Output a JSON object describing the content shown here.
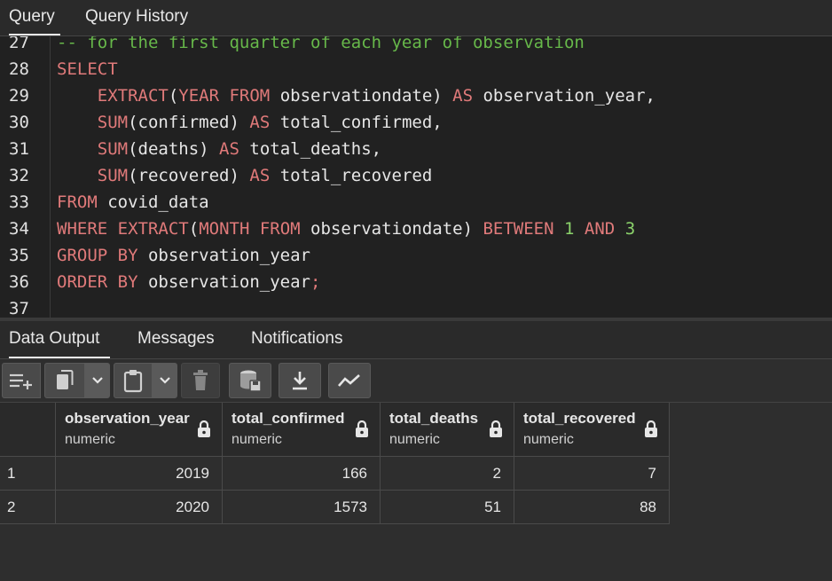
{
  "top_tabs": [
    {
      "label": "Query"
    },
    {
      "label": "Query History"
    }
  ],
  "editor": {
    "lines": [
      {
        "no": "27",
        "tokens": [
          {
            "t": "-- for the first quarter of each year of observation",
            "c": "cmt"
          }
        ]
      },
      {
        "no": "28",
        "tokens": [
          {
            "t": "SELECT",
            "c": "kw"
          }
        ]
      },
      {
        "no": "29",
        "tokens": [
          {
            "t": "    ",
            "c": "txt"
          },
          {
            "t": "EXTRACT",
            "c": "kw"
          },
          {
            "t": "(",
            "c": "txt"
          },
          {
            "t": "YEAR FROM",
            "c": "kw"
          },
          {
            "t": " observationdate) ",
            "c": "txt"
          },
          {
            "t": "AS",
            "c": "kw"
          },
          {
            "t": " observation_year,",
            "c": "txt"
          }
        ]
      },
      {
        "no": "30",
        "tokens": [
          {
            "t": "    ",
            "c": "txt"
          },
          {
            "t": "SUM",
            "c": "kw"
          },
          {
            "t": "(confirmed) ",
            "c": "txt"
          },
          {
            "t": "AS",
            "c": "kw"
          },
          {
            "t": " total_confirmed,",
            "c": "txt"
          }
        ]
      },
      {
        "no": "31",
        "tokens": [
          {
            "t": "    ",
            "c": "txt"
          },
          {
            "t": "SUM",
            "c": "kw"
          },
          {
            "t": "(deaths) ",
            "c": "txt"
          },
          {
            "t": "AS",
            "c": "kw"
          },
          {
            "t": " total_deaths,",
            "c": "txt"
          }
        ]
      },
      {
        "no": "32",
        "tokens": [
          {
            "t": "    ",
            "c": "txt"
          },
          {
            "t": "SUM",
            "c": "kw"
          },
          {
            "t": "(recovered) ",
            "c": "txt"
          },
          {
            "t": "AS",
            "c": "kw"
          },
          {
            "t": " total_recovered",
            "c": "txt"
          }
        ]
      },
      {
        "no": "33",
        "tokens": [
          {
            "t": "FROM",
            "c": "kw"
          },
          {
            "t": " covid_data",
            "c": "txt"
          }
        ]
      },
      {
        "no": "34",
        "tokens": [
          {
            "t": "WHERE",
            "c": "kw"
          },
          {
            "t": " ",
            "c": "txt"
          },
          {
            "t": "EXTRACT",
            "c": "kw"
          },
          {
            "t": "(",
            "c": "txt"
          },
          {
            "t": "MONTH FROM",
            "c": "kw"
          },
          {
            "t": " observationdate) ",
            "c": "txt"
          },
          {
            "t": "BETWEEN",
            "c": "kw"
          },
          {
            "t": " ",
            "c": "txt"
          },
          {
            "t": "1",
            "c": "num"
          },
          {
            "t": " ",
            "c": "txt"
          },
          {
            "t": "AND",
            "c": "kw"
          },
          {
            "t": " ",
            "c": "txt"
          },
          {
            "t": "3",
            "c": "num"
          }
        ]
      },
      {
        "no": "35",
        "tokens": [
          {
            "t": "GROUP BY",
            "c": "kw"
          },
          {
            "t": " observation_year",
            "c": "txt"
          }
        ]
      },
      {
        "no": "36",
        "tokens": [
          {
            "t": "ORDER BY",
            "c": "kw"
          },
          {
            "t": " observation_year",
            "c": "txt"
          },
          {
            "t": ";",
            "c": "kw"
          }
        ]
      },
      {
        "no": "37",
        "tokens": []
      }
    ]
  },
  "bottom_tabs": [
    {
      "label": "Data Output"
    },
    {
      "label": "Messages"
    },
    {
      "label": "Notifications"
    }
  ],
  "toolbar": {
    "icons": [
      "add-row-icon",
      "copy-icon",
      "chevron-down-icon",
      "paste-icon",
      "chevron-down-icon",
      "delete-icon",
      "save-data-icon",
      "download-icon",
      "graph-icon"
    ]
  },
  "grid": {
    "columns": [
      {
        "name": "observation_year",
        "type": "numeric"
      },
      {
        "name": "total_confirmed",
        "type": "numeric"
      },
      {
        "name": "total_deaths",
        "type": "numeric"
      },
      {
        "name": "total_recovered",
        "type": "numeric"
      }
    ],
    "rows": [
      {
        "n": "1",
        "cells": [
          "2019",
          "166",
          "2",
          "7"
        ]
      },
      {
        "n": "2",
        "cells": [
          "2020",
          "1573",
          "51",
          "88"
        ]
      }
    ]
  },
  "colors": {
    "keyword": "#e07a7a",
    "number": "#8bd36b",
    "comment": "#67b84a",
    "text": "#e6e6e6",
    "background": "#2e2e2e",
    "editor_background": "#212121"
  }
}
